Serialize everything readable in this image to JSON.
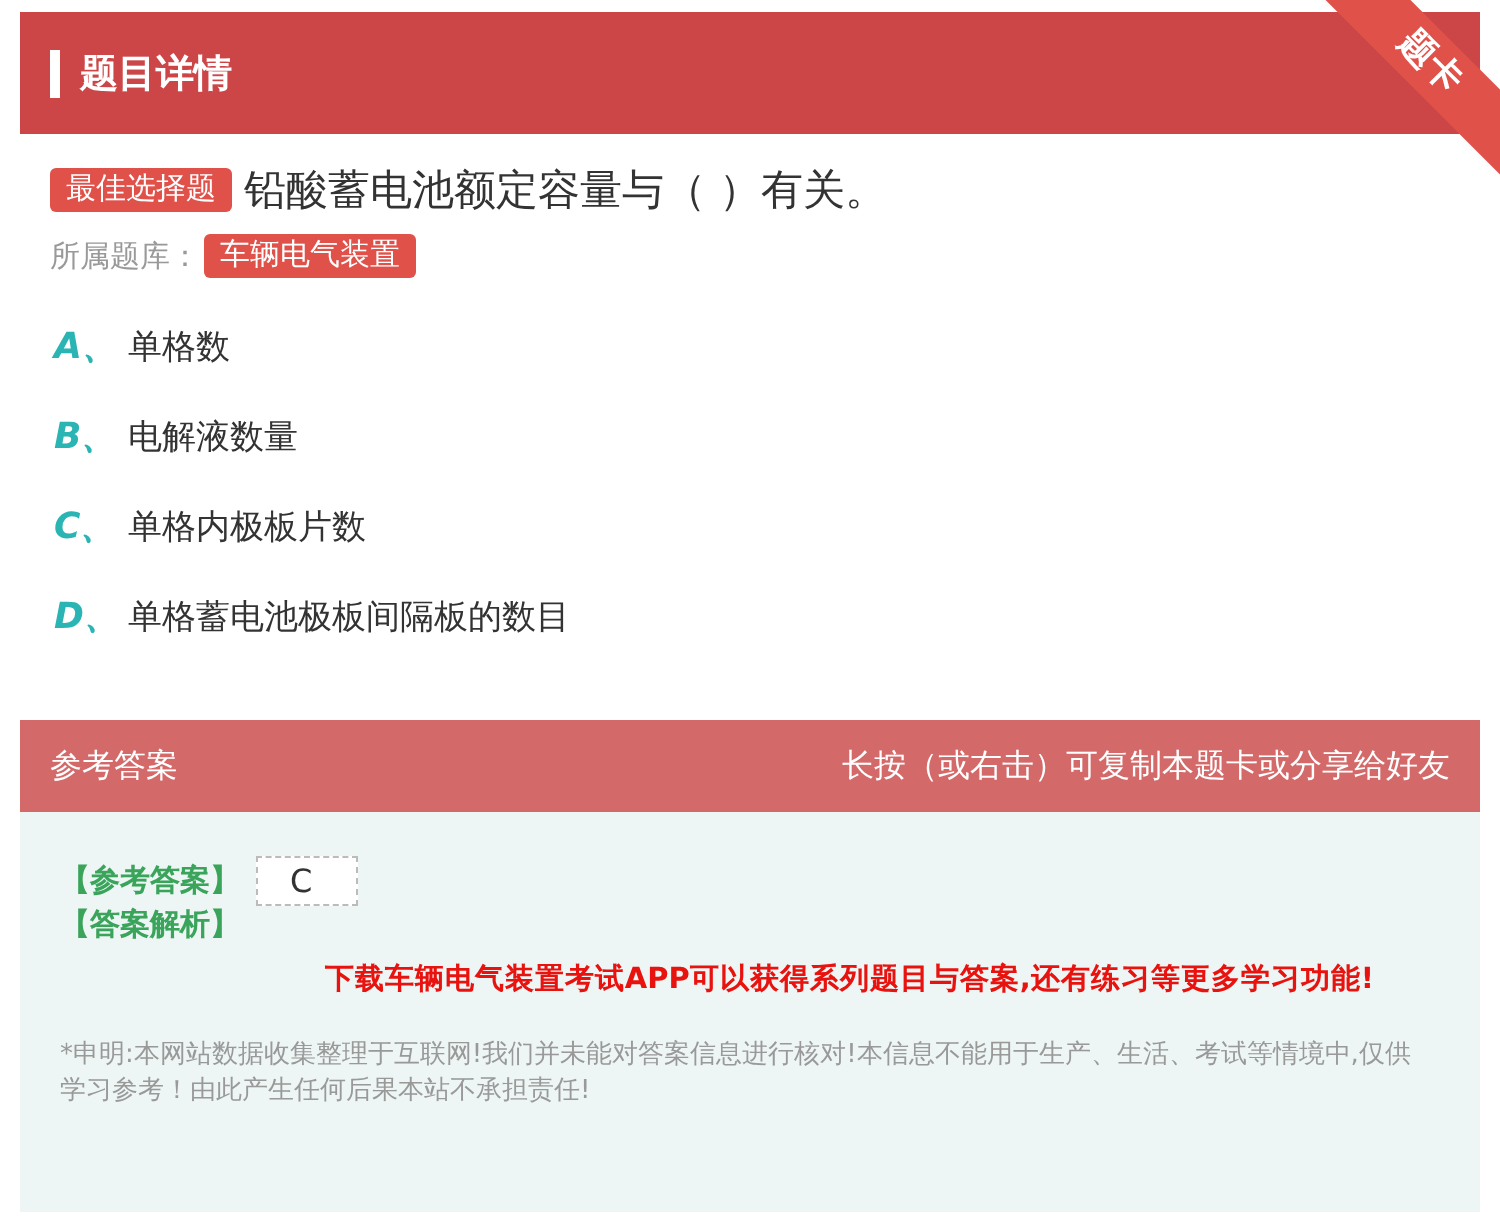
{
  "header": {
    "title": "题目详情",
    "ribbon": "题卡"
  },
  "question": {
    "type_badge": "最佳选择题",
    "text": "铅酸蓄电池额定容量与（  ）有关。",
    "bank_label": "所属题库：",
    "bank": "车辆电气装置"
  },
  "options": [
    {
      "letter": "A、",
      "text": "单格数"
    },
    {
      "letter": "B、",
      "text": "电解液数量"
    },
    {
      "letter": "C、",
      "text": "单格内极板片数"
    },
    {
      "letter": "D、",
      "text": "单格蓄电池极板间隔板的数目"
    }
  ],
  "answer_bar": {
    "title": "参考答案",
    "hint": "长按（或右击）可复制本题卡或分享给好友"
  },
  "answer": {
    "answer_label": "【参考答案】",
    "answer_value": "C",
    "analysis_label": "【答案解析】",
    "promo": "下载车辆电气装置考试APP可以获得系列题目与答案,还有练习等更多学习功能!",
    "disclaimer": "*申明:本网站数据收集整理于互联网!我们并未能对答案信息进行核对!本信息不能用于生产、生活、考试等情境中,仅供学习参考！由此产生任何后果本站不承担责任!"
  }
}
